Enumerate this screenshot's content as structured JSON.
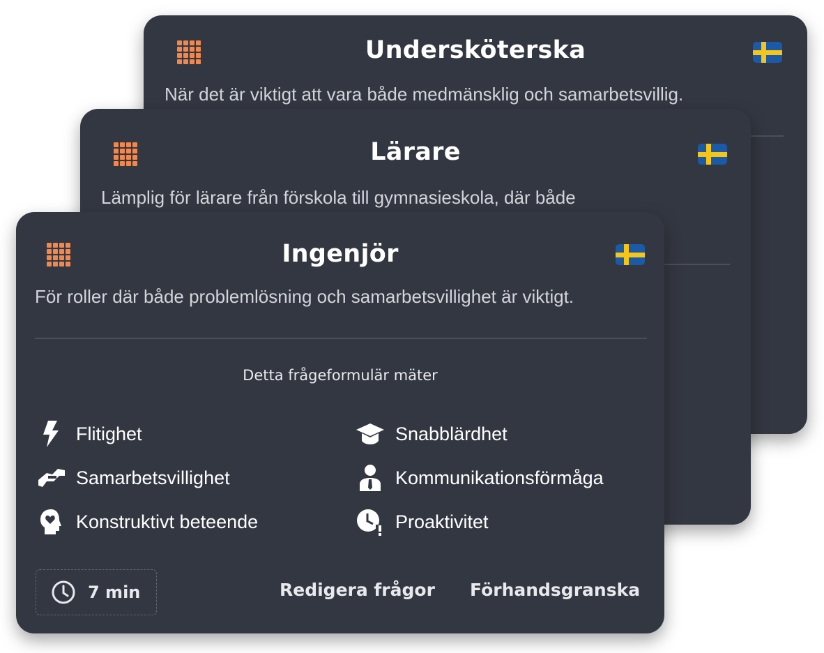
{
  "cards": [
    {
      "title": "Undersköterska",
      "description": "När det är viktigt att vara både medmänsklig och samarbetsvillig."
    },
    {
      "title": "Lärare",
      "description": "Lämplig för lärare från förskola till gymnasieskola, där både"
    },
    {
      "title": "Ingenjör",
      "description": "För roller där både problemlösning och samarbetsvillighet är viktigt.",
      "measures_title": "Detta frågeformulär mäter",
      "traits_left": [
        {
          "label": "Flitighet",
          "icon": "lightning-icon"
        },
        {
          "label": "Samarbetsvillighet",
          "icon": "handshake-icon"
        },
        {
          "label": "Konstruktivt beteende",
          "icon": "head-heart-icon"
        }
      ],
      "traits_right": [
        {
          "label": "Snabblärdhet",
          "icon": "graduation-cap-icon"
        },
        {
          "label": "Kommunikationsförmåga",
          "icon": "person-tie-icon"
        },
        {
          "label": "Proaktivitet",
          "icon": "clock-alert-icon"
        }
      ],
      "duration": "7 min",
      "edit_label": "Redigera frågor",
      "preview_label": "Förhandsgranska"
    }
  ],
  "colors": {
    "card_bg": "#333741",
    "accent_orange": "#f2884d",
    "flag_blue": "#1a5aa7",
    "flag_yellow": "#f5c518"
  }
}
